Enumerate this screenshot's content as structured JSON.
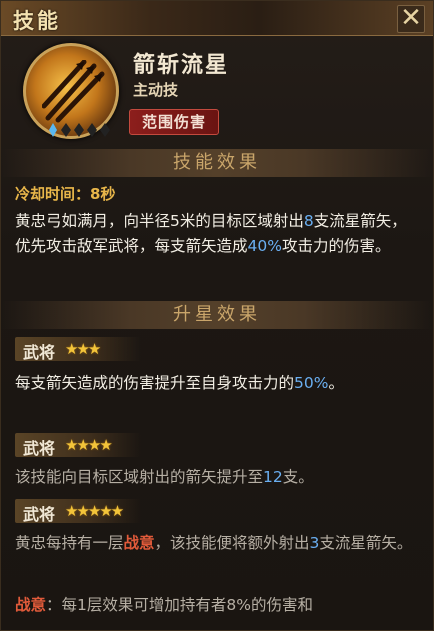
{
  "window": {
    "title": "技能"
  },
  "skill": {
    "name": "箭斩流星",
    "type": "主动技",
    "tag": "范围伤害"
  },
  "effects": {
    "header": "技能效果",
    "cooldown": "冷却时间：8秒",
    "desc_parts": {
      "p1": "黄忠弓如满月，向半径5米的目标区域射出",
      "n1": "8",
      "p2": "支流星箭矢，优先攻击敌军武将，每支箭矢造成",
      "n2": "40%",
      "p3": "攻击力的伤害。"
    }
  },
  "upgrades": {
    "header": "升星效果",
    "items": [
      {
        "label": "武将",
        "stars": "★★★",
        "star_count": 3,
        "text_a": "每支箭矢造成的伤害提升至自身攻击力的",
        "num": "50%",
        "text_b": "。"
      },
      {
        "label": "武将",
        "stars": "★★★★",
        "star_count": 4,
        "text_a": "该技能向目标区域射出的箭矢提升至",
        "num": "12",
        "text_b": "支。"
      },
      {
        "label": "武将",
        "stars": "★★★★★",
        "star_count": 5,
        "text_a": "黄忠每持有一层",
        "hl": "战意",
        "text_b": "，该技能便将额外射出",
        "num": "3",
        "text_c": "支流星箭矢。"
      }
    ]
  },
  "footnote": {
    "term": "战意",
    "text": "：每1层效果可增加持有者8%的伤害和"
  },
  "colors": {
    "accent_gold": "#e8b64a",
    "number_blue": "#6aaef0",
    "highlight_red": "#e05a3a"
  }
}
